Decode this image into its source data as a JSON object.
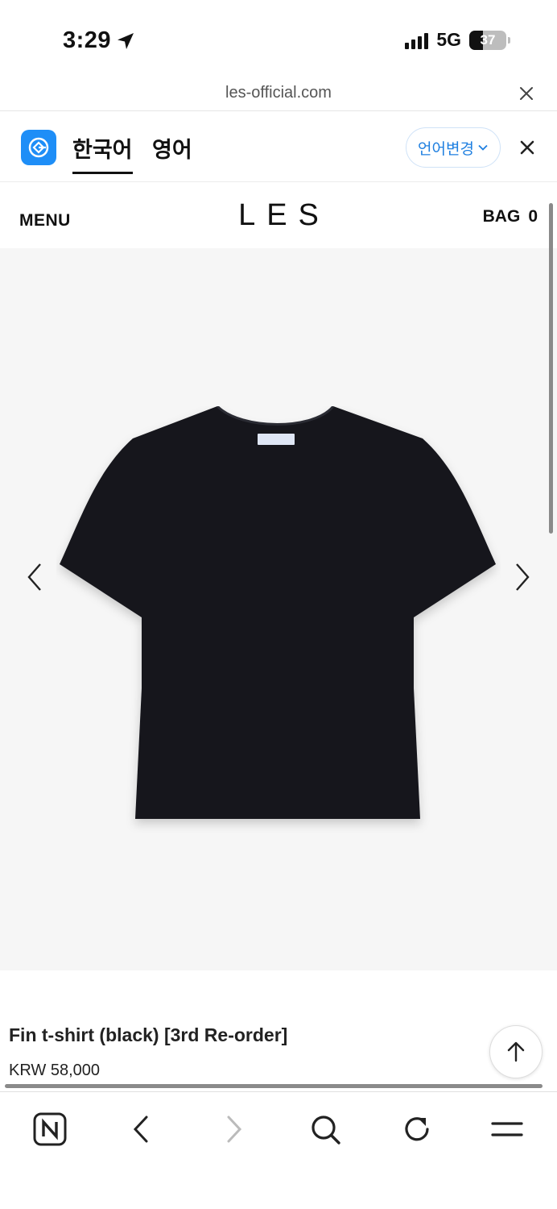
{
  "status_bar": {
    "time": "3:29",
    "network": "5G",
    "battery": "37",
    "battery_level": 0.37
  },
  "browser": {
    "url": "les-official.com"
  },
  "translate_bar": {
    "languages": [
      {
        "label": "한국어",
        "active": true
      },
      {
        "label": "영어",
        "active": false
      }
    ],
    "change_label": "언어변경"
  },
  "site_header": {
    "menu_label": "MENU",
    "logo": "LES",
    "bag_label": "BAG",
    "bag_count": "0"
  },
  "product": {
    "name": "Fin t-shirt (black) [3rd Re-order]",
    "price": "KRW 58,000",
    "image_icon": "black-tshirt-image"
  },
  "toolbar": {
    "icons": [
      "naver-home-icon",
      "back-icon",
      "forward-icon",
      "search-icon",
      "reload-icon",
      "menu-icon"
    ]
  },
  "colors": {
    "accent": "#1e8ef7",
    "link": "#1e7fe0",
    "shirt": "#15161c",
    "gallery_bg": "#f6f6f6"
  }
}
